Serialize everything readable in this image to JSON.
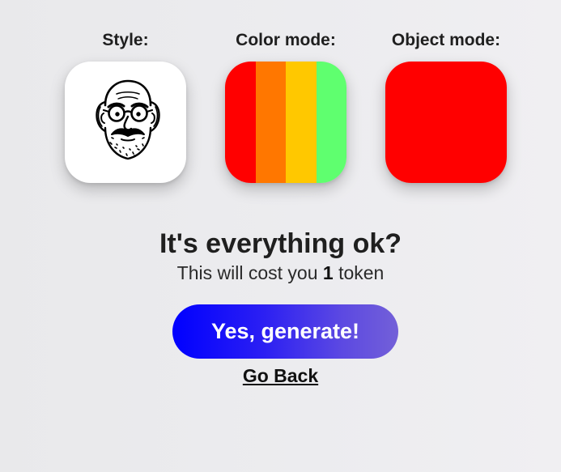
{
  "options": {
    "style": {
      "label": "Style:",
      "icon": "cartoon-face-icon"
    },
    "color_mode": {
      "label": "Color mode:",
      "colors": [
        "#ff0000",
        "#ff7700",
        "#ffc800",
        "#5fff6f"
      ]
    },
    "object_mode": {
      "label": "Object mode:",
      "color": "#ff0000"
    }
  },
  "confirm": {
    "headline": "It's everything ok?",
    "cost_prefix": "This will cost you",
    "cost_amount": "1",
    "cost_suffix": "token"
  },
  "actions": {
    "generate_label": "Yes, generate!",
    "back_label": "Go Back"
  }
}
